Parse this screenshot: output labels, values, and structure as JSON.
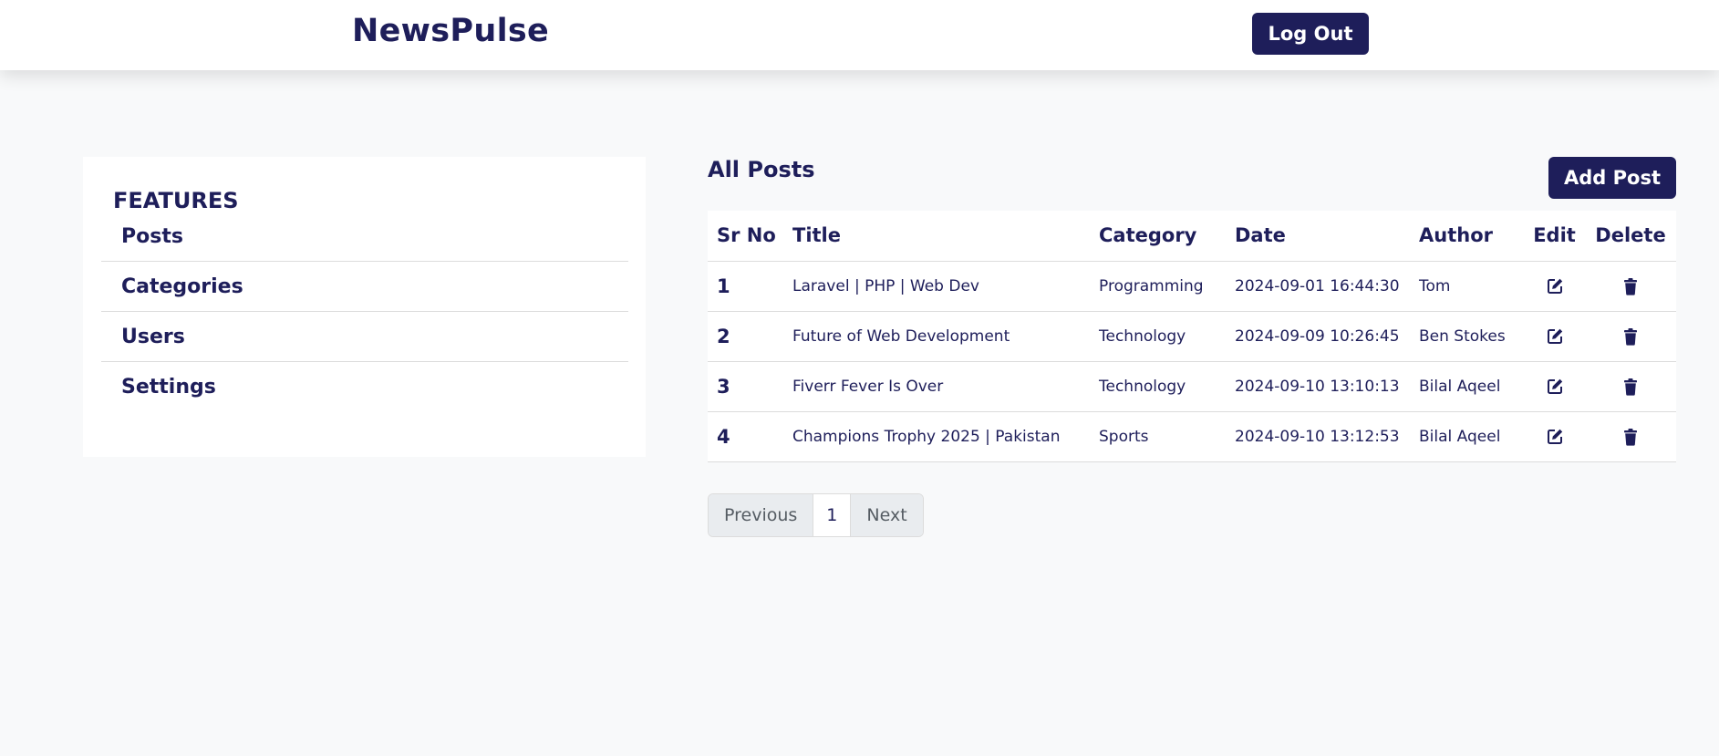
{
  "navbar": {
    "brand": "NewsPulse",
    "logout_label": "Log Out"
  },
  "sidebar": {
    "heading": "FEATURES",
    "items": [
      {
        "label": "Posts"
      },
      {
        "label": "Categories"
      },
      {
        "label": "Users"
      },
      {
        "label": "Settings"
      }
    ]
  },
  "main": {
    "heading": "All Posts",
    "add_label": "Add Post",
    "columns": [
      "Sr No",
      "Title",
      "Category",
      "Date",
      "Author",
      "Edit",
      "Delete"
    ],
    "rows": [
      {
        "sr": "1",
        "title": "Laravel | PHP | Web Dev",
        "category": "Programming",
        "date": "2024-09-01 16:44:30",
        "author": "Tom"
      },
      {
        "sr": "2",
        "title": "Future of Web Development",
        "category": "Technology",
        "date": "2024-09-09 10:26:45",
        "author": "Ben Stokes"
      },
      {
        "sr": "3",
        "title": "Fiverr Fever Is Over",
        "category": "Technology",
        "date": "2024-09-10 13:10:13",
        "author": "Bilal Aqeel"
      },
      {
        "sr": "4",
        "title": "Champions Trophy 2025 | Pakistan",
        "category": "Sports",
        "date": "2024-09-10 13:12:53",
        "author": "Bilal Aqeel"
      }
    ],
    "row_icons": {
      "edit": "edit-icon",
      "delete": "trash-icon"
    }
  },
  "pagination": {
    "previous_label": "Previous",
    "current_page": "1",
    "next_label": "Next"
  },
  "colors": {
    "primary": "#1e1e5a",
    "background": "#f8f9fa",
    "pagination_inactive": "#e9ecef"
  }
}
